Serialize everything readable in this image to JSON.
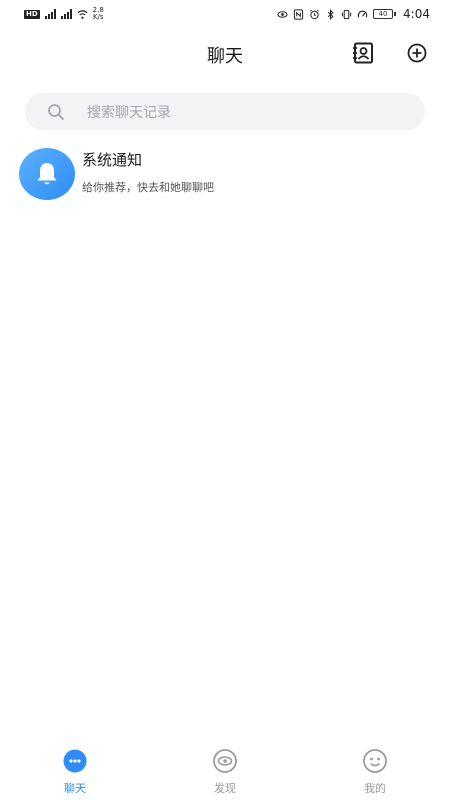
{
  "status_bar": {
    "hd_label": "HD",
    "net_speed_value": "2.8",
    "net_speed_unit": "K/s",
    "battery": "40",
    "time": "4:04"
  },
  "header": {
    "title": "聊天",
    "contacts_icon": "contacts-icon",
    "add_icon": "add-circle-icon"
  },
  "search": {
    "placeholder": "搜索聊天记录",
    "icon": "search-icon"
  },
  "conversations": [
    {
      "name": "系统通知",
      "preview": "给你推荐，快去和她聊聊吧",
      "avatar_icon": "bell-icon",
      "avatar_color": "#3a96f7"
    }
  ],
  "tabs": [
    {
      "label": "聊天",
      "icon": "chat-bubble-icon",
      "active": true
    },
    {
      "label": "发现",
      "icon": "eye-icon",
      "active": false
    },
    {
      "label": "我的",
      "icon": "smile-icon",
      "active": false
    }
  ],
  "colors": {
    "accent": "#2f8cf5",
    "inactive": "#9a9a9a",
    "search_bg": "#f2f3f5"
  }
}
